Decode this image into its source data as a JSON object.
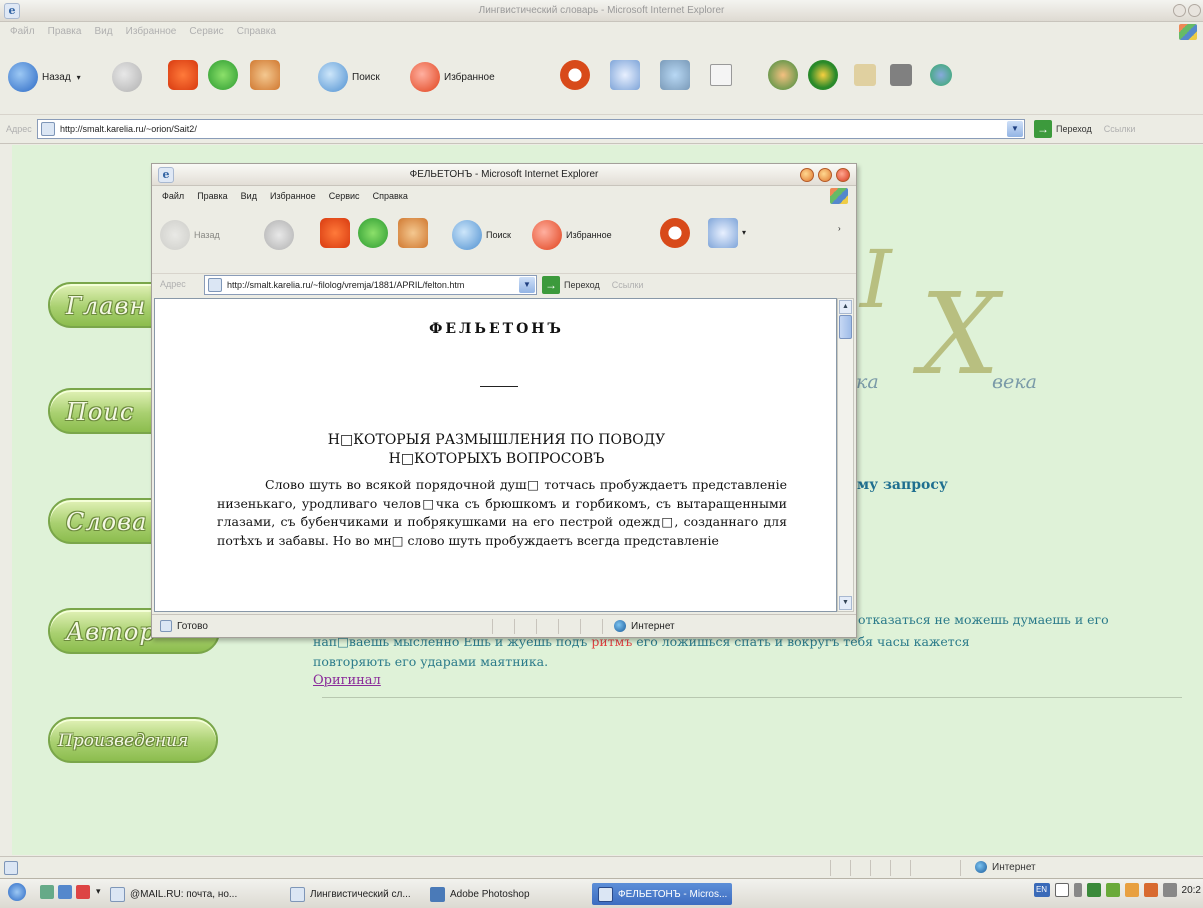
{
  "bg_window": {
    "title": "Лингвистический словарь - Microsoft Internet Explorer",
    "menu": [
      "Файл",
      "Правка",
      "Вид",
      "Избранное",
      "Сервис",
      "Справка"
    ],
    "toolbar": {
      "back_label": "Назад",
      "search_label": "Поиск",
      "favorites_label": "Избранное"
    },
    "address_label": "Адрес",
    "url": "http://smalt.karelia.ru/~orion/Sait2/",
    "go_label": "Переход",
    "links_label": "Ссылки",
    "status_zone": "Интернет"
  },
  "bg_page": {
    "nav_buttons": [
      "Главн",
      "Поис",
      "Слова",
      "Автор",
      "Произведения"
    ],
    "deco_roman_1": "I",
    "deco_roman_2": "X",
    "deco_ka": "ка",
    "deco_veka": "века",
    "query_heading": "му запросу",
    "line1": "отказаться не можешь думаешь и его",
    "line2a": "нап□ваешь мысленно Ешь и жуешь подъ ",
    "line2_red": "ритмъ",
    "line2b": " его ложишься спать и вокругъ тебя часы кажется",
    "line3": "повторяють его ударами маятника.",
    "original_link": "Оригинал"
  },
  "popup": {
    "title": "ФЕЛЬЕТОНЪ - Microsoft Internet Explorer",
    "menu": [
      "Файл",
      "Правка",
      "Вид",
      "Избранное",
      "Сервис",
      "Справка"
    ],
    "toolbar": {
      "back_label": "Назад",
      "search_label": "Поиск",
      "favorites_label": "Избранное"
    },
    "address_label": "Адрес",
    "url": "http://smalt.karelia.ru/~filolog/vremja/1881/APRIL/felton.htm",
    "go_label": "Переход",
    "links_label": "Ссылки",
    "status_text": "Готово",
    "status_zone": "Интернет"
  },
  "document": {
    "title": "ФЕЛЬЕТОНЪ",
    "subtitle_line1": "Н□КОТОРЫЯ РАЗМЫШЛЕНИЯ ПО ПОВОДУ",
    "subtitle_line2": "Н□КОТОРЫХЪ ВОПРОСОВЪ",
    "paragraph": "Слово шуть во всякой порядочной душ□ тотчась пробуждаетъ представленiе низенькаго, уродливаго челов□чка съ брюшкомъ и горбикомъ, съ вытаращенными глазами, съ бубенчиками и побрякушками на его пестрой одежд□, созданнаго для потѣхъ и забавы. Но во мн□ слово шуть пробуждаетъ всегда представленiе"
  },
  "taskbar": {
    "items": [
      "@MAIL.RU: почта, но...",
      "Лингвистический сл...",
      "Adobe Photoshop",
      "ФЕЛЬЕТОНЪ - Micros..."
    ],
    "lang": "EN",
    "clock": "20:2"
  },
  "colors": {
    "page_bg": "#dff2d8",
    "nav_green": "#a9d070",
    "text_teal": "#2a7a8a",
    "link_purple": "#8a2a9a"
  }
}
